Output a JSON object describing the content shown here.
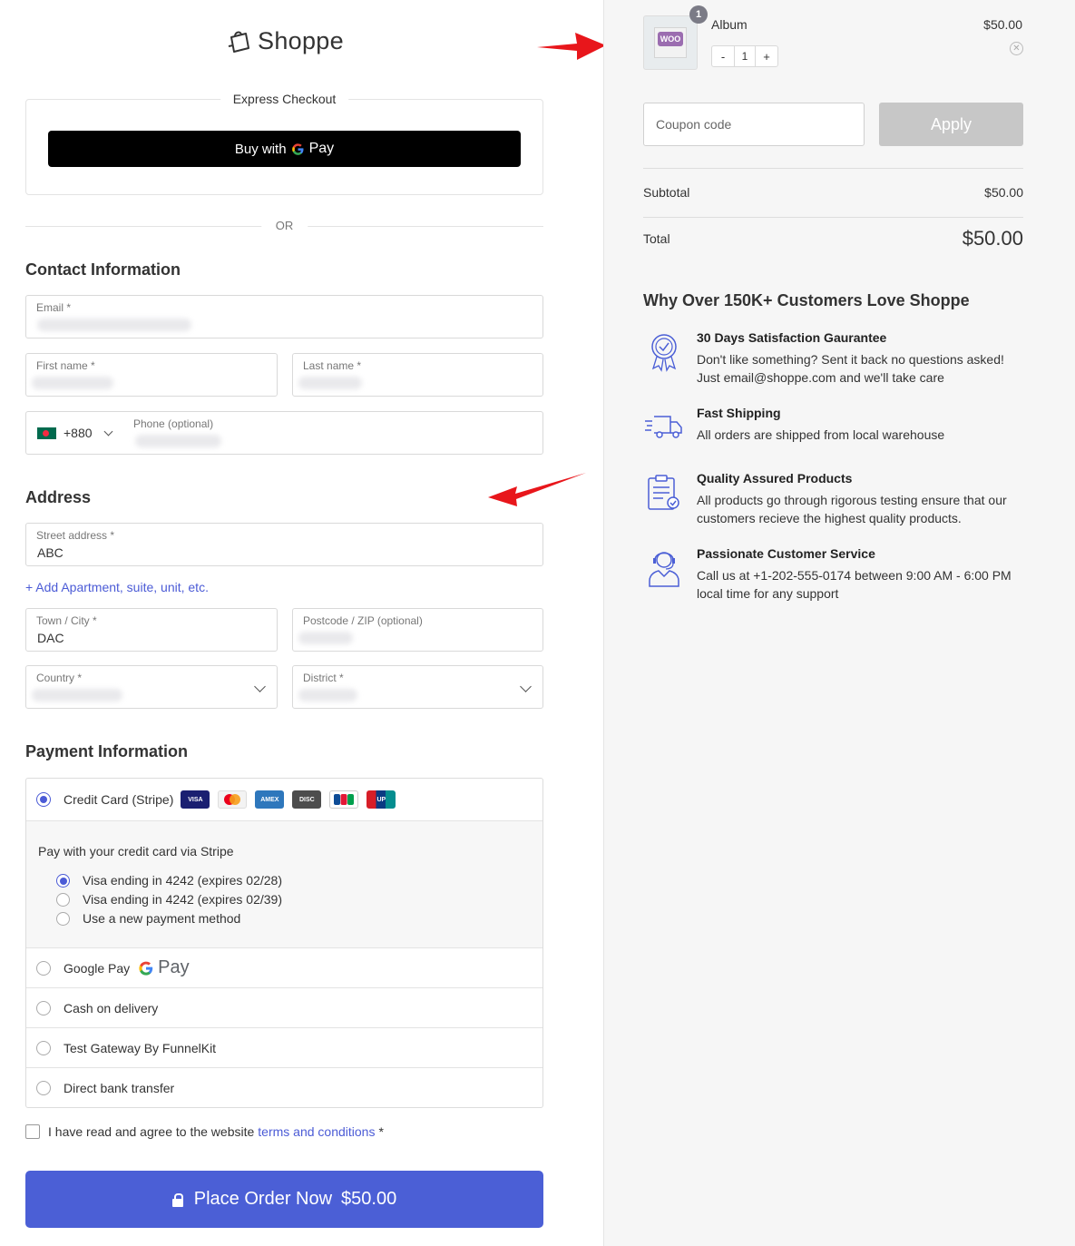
{
  "brand": {
    "name": "Shoppe"
  },
  "express": {
    "title": "Express Checkout",
    "buy_with": "Buy with",
    "pay": "Pay"
  },
  "divider": {
    "or": "OR"
  },
  "contact": {
    "title": "Contact Information",
    "email_label": "Email *",
    "first_name_label": "First name *",
    "last_name_label": "Last name *",
    "phone_prefix": "+880",
    "phone_label": "Phone (optional)"
  },
  "address": {
    "title": "Address",
    "street_label": "Street address *",
    "street_value": "ABC",
    "add_apartment": "+ Add Apartment, suite, unit, etc.",
    "city_label": "Town / City *",
    "city_value": "DAC",
    "postcode_label": "Postcode / ZIP (optional)",
    "country_label": "Country *",
    "district_label": "District *"
  },
  "payment": {
    "title": "Payment Information",
    "credit_card_label": "Credit Card (Stripe)",
    "cards": [
      "VISA",
      "MC",
      "AMEX",
      "DISCOVER",
      "JCB",
      "UnionPay"
    ],
    "stripe_head": "Pay with your credit card via Stripe",
    "saved_methods": [
      "Visa ending in 4242 (expires 02/28)",
      "Visa ending in 4242 (expires 02/39)",
      "Use a new payment method"
    ],
    "google_pay_label": "Google Pay",
    "google_pay_logo": "Pay",
    "cod_label": "Cash on delivery",
    "test_gateway_label": "Test Gateway By FunnelKit",
    "bank_label": "Direct bank transfer"
  },
  "terms": {
    "prefix": "I have read and agree to the website",
    "link": "terms and conditions",
    "suffix": "*"
  },
  "place_order": {
    "label": "Place Order Now",
    "amount": "$50.00"
  },
  "cart": {
    "item_name": "Album",
    "item_price": "$50.00",
    "quantity": "1",
    "badge": "1",
    "minus": "-",
    "plus": "+",
    "thumb_text": "WOO"
  },
  "coupon": {
    "placeholder": "Coupon code",
    "apply": "Apply"
  },
  "summary": {
    "subtotal_label": "Subtotal",
    "subtotal_value": "$50.00",
    "total_label": "Total",
    "total_value": "$50.00"
  },
  "why": {
    "title": "Why Over 150K+ Customers Love Shoppe",
    "features": [
      {
        "title": "30 Days Satisfaction Gaurantee",
        "desc": "Don't like something? Sent it back no questions asked! Just email@shoppe.com and we'll take care"
      },
      {
        "title": "Fast Shipping",
        "desc": "All orders are shipped from local warehouse"
      },
      {
        "title": "Quality Assured Products",
        "desc": "All products go through rigorous testing ensure that our customers recieve the highest quality products."
      },
      {
        "title": "Passionate Customer Service",
        "desc": "Call us at +1-202-555-0174 between 9:00 AM - 6:00 PM local time for any support"
      }
    ]
  },
  "colors": {
    "accent": "#4b5fd6",
    "arrow": "#e8161b",
    "apply_disabled": "#c7c7c7"
  }
}
